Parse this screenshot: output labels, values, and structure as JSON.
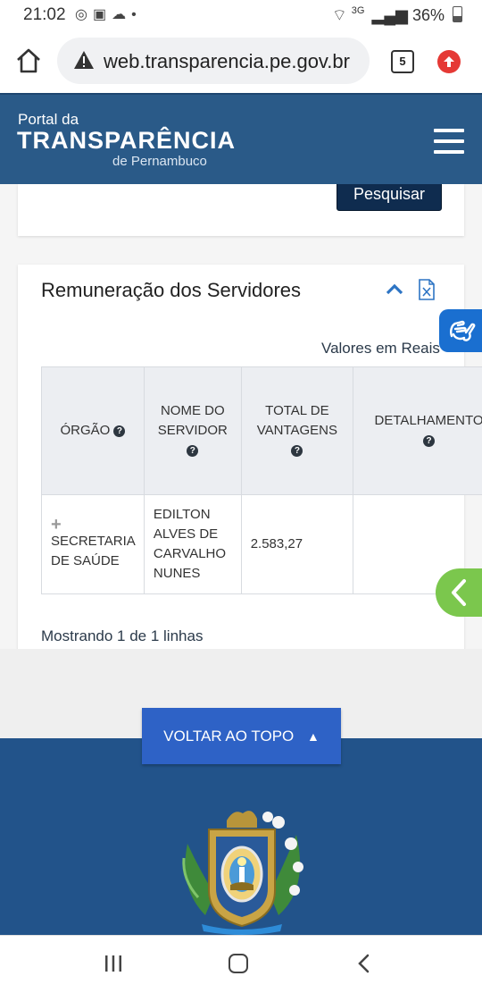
{
  "status_bar": {
    "time": "21:02",
    "network": "3G",
    "battery": "36%"
  },
  "browser": {
    "url": "web.transparencia.pe.gov.br",
    "tab_count": "5"
  },
  "site_header": {
    "logo_line1": "Portal da",
    "logo_line2": "TRANSPARÊNCIA",
    "logo_line3": "de Pernambuco"
  },
  "search": {
    "button_label": "Pesquisar"
  },
  "results": {
    "title": "Remuneração dos Servidores",
    "currency_note": "Valores em Reais",
    "columns": [
      {
        "label": "ÓRGÃO"
      },
      {
        "label": "NOME DO SERVIDOR"
      },
      {
        "label": "TOTAL DE VANTAGENS"
      },
      {
        "label": "DETALHAMENTO"
      }
    ],
    "rows": [
      {
        "orgao": "SECRETARIA DE SAÚDE",
        "nome": "EDILTON ALVES DE CARVALHO NUNES",
        "total": "2.583,27",
        "detalhamento": ""
      }
    ],
    "footer_text": "Mostrando 1 de 1 linhas"
  },
  "back_to_top": {
    "label": "VOLTAR AO TOPO"
  },
  "colors": {
    "header_bg": "#2a5a88",
    "footer_bg": "#22538a",
    "button_blue": "#2e62c6",
    "green_tab": "#7bc74d"
  }
}
